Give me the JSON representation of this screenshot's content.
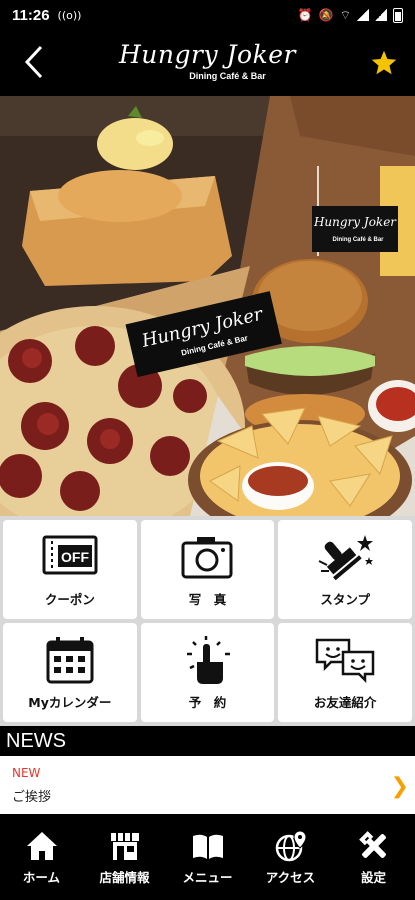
{
  "status_bar": {
    "time": "11:26"
  },
  "header": {
    "logo_main": "Hungry Joker",
    "logo_sub": "Dining Café & Bar",
    "star_color": "#f5c400"
  },
  "hero": {
    "burger_flag_main": "Hungry Joker",
    "burger_flag_sub": "Dining Café & Bar",
    "banner_main": "Hungry Joker",
    "banner_sub": "Dining Café & Bar"
  },
  "menu_tiles": [
    {
      "label": "クーポン",
      "icon": "coupon-ticket-icon",
      "badge": "OFF"
    },
    {
      "label": "写　真",
      "icon": "camera-icon"
    },
    {
      "label": "スタンプ",
      "icon": "stamp-icon"
    },
    {
      "label": "Myカレンダー",
      "icon": "calendar-icon"
    },
    {
      "label": "予　約",
      "icon": "reservation-hand-icon"
    },
    {
      "label": "お友達紹介",
      "icon": "friend-referral-icon"
    }
  ],
  "news": {
    "heading": "NEWS",
    "items": [
      {
        "badge": "NEW",
        "title": "ご挨拶",
        "badge_color": "#e8352a"
      }
    ],
    "chevron_color": "#f5a000"
  },
  "tabbar": [
    {
      "label": "ホーム",
      "icon": "home-icon"
    },
    {
      "label": "店舗情報",
      "icon": "store-icon"
    },
    {
      "label": "メニュー",
      "icon": "menu-book-icon"
    },
    {
      "label": "アクセス",
      "icon": "access-globe-icon"
    },
    {
      "label": "設定",
      "icon": "settings-tools-icon"
    }
  ]
}
